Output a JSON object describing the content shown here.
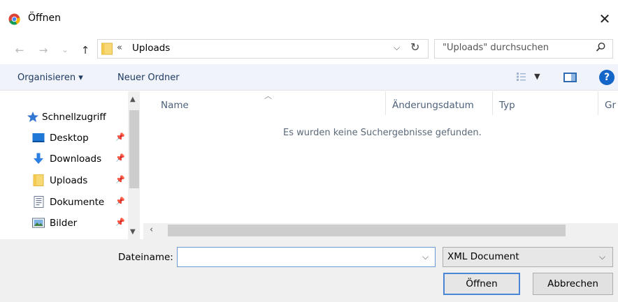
{
  "window": {
    "title": "Öffnen",
    "close_glyph": "✕"
  },
  "nav": {
    "back_glyph": "←",
    "forward_glyph": "→",
    "recent_glyph": "⌄",
    "up_glyph": "↑",
    "path_prefix": "«",
    "current_folder": "Uploads",
    "search_placeholder": "\"Uploads\" durchsuchen"
  },
  "toolbar": {
    "organize_label": "Organisieren ▾",
    "new_folder_label": "Neuer Ordner",
    "help_glyph": "?"
  },
  "sidebar": {
    "quick_access": "Schnellzugriff",
    "items": [
      {
        "label": "Desktop",
        "icon": "desktop-icon"
      },
      {
        "label": "Downloads",
        "icon": "download-icon"
      },
      {
        "label": "Uploads",
        "icon": "folder-icon"
      },
      {
        "label": "Dokumente",
        "icon": "document-icon"
      },
      {
        "label": "Bilder",
        "icon": "pictures-icon"
      }
    ]
  },
  "columns": [
    "Name",
    "Änderungsdatum",
    "Typ",
    "Gr"
  ],
  "empty_message": "Es wurden keine Suchergebnisse gefunden.",
  "bottom": {
    "filename_label": "Dateiname:",
    "filename_value": "",
    "filetype_selected": "XML Document",
    "open_label": "Öffnen",
    "cancel_label": "Abbrechen"
  },
  "colors": {
    "accent": "#1466c8",
    "toolbar_bg": "#f0f3f9",
    "bottom_bg": "#f0f0f0"
  }
}
